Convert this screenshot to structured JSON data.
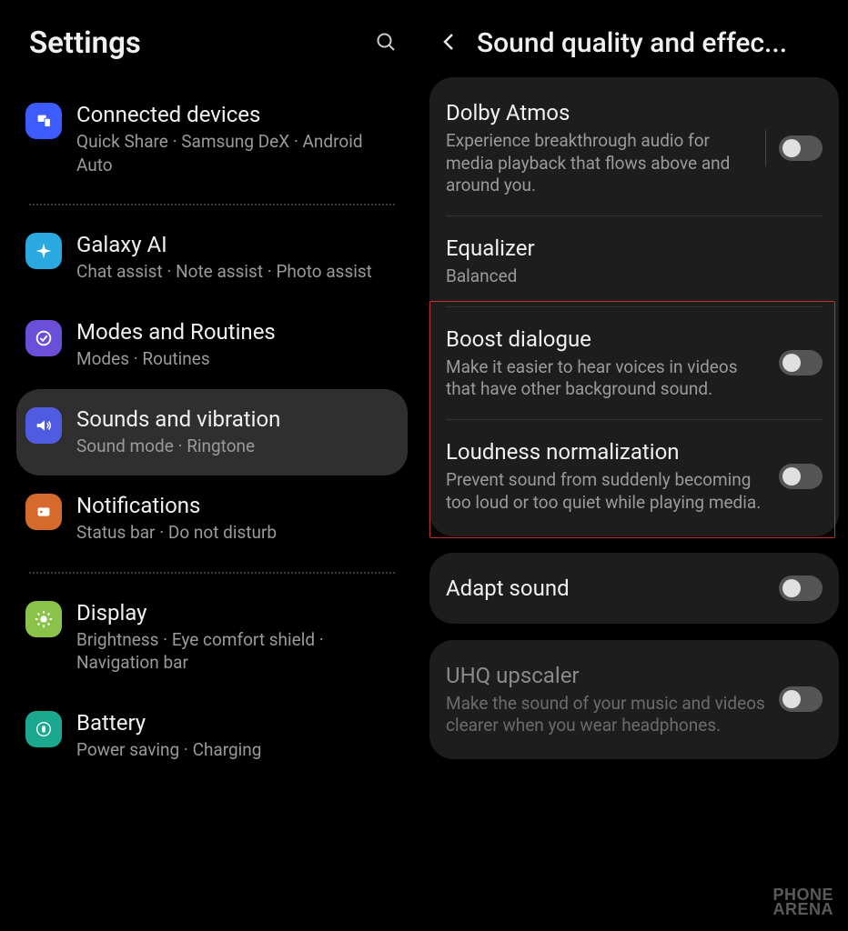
{
  "left": {
    "title": "Settings",
    "items": [
      {
        "title": "Connected devices",
        "sub": "Quick Share · Samsung DeX · Android Auto",
        "icon_bg": "#3d5cff",
        "icon": "devices"
      },
      {
        "title": "Galaxy AI",
        "sub": "Chat assist · Note assist · Photo assist",
        "icon_bg": "#2aa9e0",
        "icon": "sparkle"
      },
      {
        "title": "Modes and Routines",
        "sub": "Modes · Routines",
        "icon_bg": "#6b4fd8",
        "icon": "check"
      },
      {
        "title": "Sounds and vibration",
        "sub": "Sound mode · Ringtone",
        "icon_bg": "#4f5be0",
        "icon": "sound",
        "selected": true
      },
      {
        "title": "Notifications",
        "sub": "Status bar · Do not disturb",
        "icon_bg": "#d56a2c",
        "icon": "notif"
      },
      {
        "title": "Display",
        "sub": "Brightness · Eye comfort shield · Navigation bar",
        "icon_bg": "#8bc34a",
        "icon": "brightness"
      },
      {
        "title": "Battery",
        "sub": "Power saving · Charging",
        "icon_bg": "#1aa890",
        "icon": "battery"
      }
    ]
  },
  "right": {
    "title": "Sound quality and effec...",
    "cards": [
      {
        "rows": [
          {
            "title": "Dolby Atmos",
            "desc": "Experience breakthrough audio for media playback that flows above and around you.",
            "toggle": true,
            "divider": true
          },
          {
            "title": "Equalizer",
            "desc": "Balanced"
          },
          {
            "title": "Boost dialogue",
            "desc": "Make it easier to hear voices in videos that have other background sound.",
            "toggle": true
          },
          {
            "title": "Loudness normalization",
            "desc": "Prevent sound from suddenly becoming too loud or too quiet while playing media.",
            "toggle": true
          }
        ]
      },
      {
        "rows": [
          {
            "title": "Adapt sound",
            "toggle": true
          }
        ]
      },
      {
        "disabled": true,
        "rows": [
          {
            "title": "UHQ upscaler",
            "desc": "Make the sound of your music and videos clearer when you wear headphones.",
            "toggle": true
          }
        ]
      }
    ]
  },
  "watermark": {
    "line1": "PHONE",
    "line2": "ARENA"
  }
}
